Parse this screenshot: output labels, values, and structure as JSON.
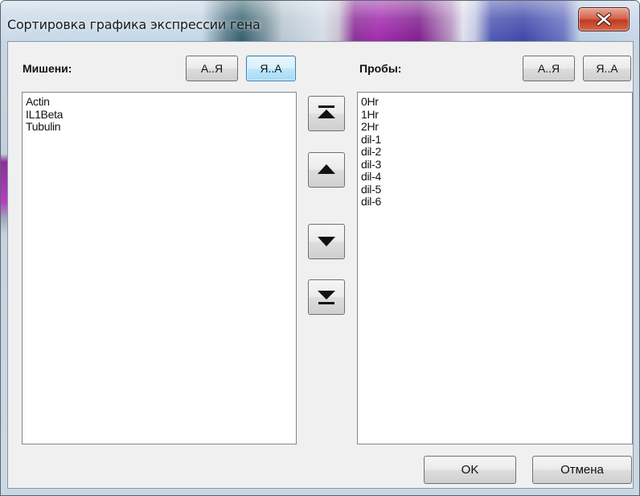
{
  "window": {
    "title": "Сортировка графика экспрессии гена"
  },
  "targets": {
    "label": "Мишени:",
    "sort_asc_label": "А..Я",
    "sort_desc_label": "Я..А",
    "items": [
      "Actin",
      "IL1Beta",
      "Tubulin"
    ]
  },
  "samples": {
    "label": "Пробы:",
    "sort_asc_label": "А..Я",
    "sort_desc_label": "Я..А",
    "items": [
      "0Hr",
      "1Hr",
      "2Hr",
      "dil-1",
      "dil-2",
      "dil-3",
      "dil-4",
      "dil-5",
      "dil-6"
    ]
  },
  "move_buttons": {
    "icons": [
      "move-to-top-icon",
      "move-up-icon",
      "move-down-icon",
      "move-to-bottom-icon"
    ]
  },
  "footer": {
    "ok_label": "OK",
    "cancel_label": "Отмена"
  },
  "colors": {
    "close_button": "#c8452b",
    "focused_button_border": "#3c7fb1",
    "dialog_background": "#f0f0f0"
  }
}
